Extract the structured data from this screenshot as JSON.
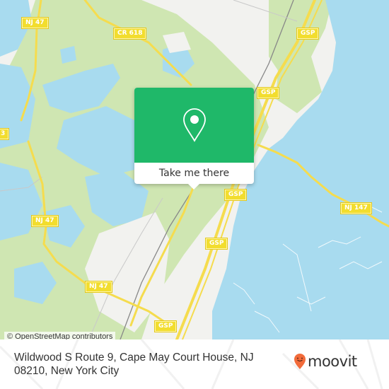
{
  "map": {
    "colors": {
      "water": "#a8dbef",
      "land": "#f2f2ef",
      "park": "#cfe6b2",
      "road": "#f5dc4e",
      "popup_green": "#1fb869",
      "brand_orange": "#f26b3a"
    },
    "road_labels": [
      {
        "id": "nj47-top",
        "text": "NJ 47"
      },
      {
        "id": "cr618",
        "text": "CR 618"
      },
      {
        "id": "gsp-1",
        "text": "GSP"
      },
      {
        "id": "gsp-2",
        "text": "GSP"
      },
      {
        "id": "gsp-3",
        "text": "GSP"
      },
      {
        "id": "gsp-4",
        "text": "GSP"
      },
      {
        "id": "gsp-5",
        "text": "GSP"
      },
      {
        "id": "nj47-mid",
        "text": "NJ 47"
      },
      {
        "id": "nj47-low",
        "text": "NJ 47"
      },
      {
        "id": "nj147",
        "text": "NJ 147"
      },
      {
        "id": "edge-label",
        "text": "3"
      }
    ],
    "attribution": "© OpenStreetMap contributors"
  },
  "popup": {
    "icon": "map-pin-icon",
    "button_label": "Take me there"
  },
  "footer": {
    "address": "Wildwood S Route 9, Cape May Court House, NJ 08210, New York City",
    "logo_icon": "moovit-smiley-pin-icon",
    "logo_text": "moovit"
  }
}
